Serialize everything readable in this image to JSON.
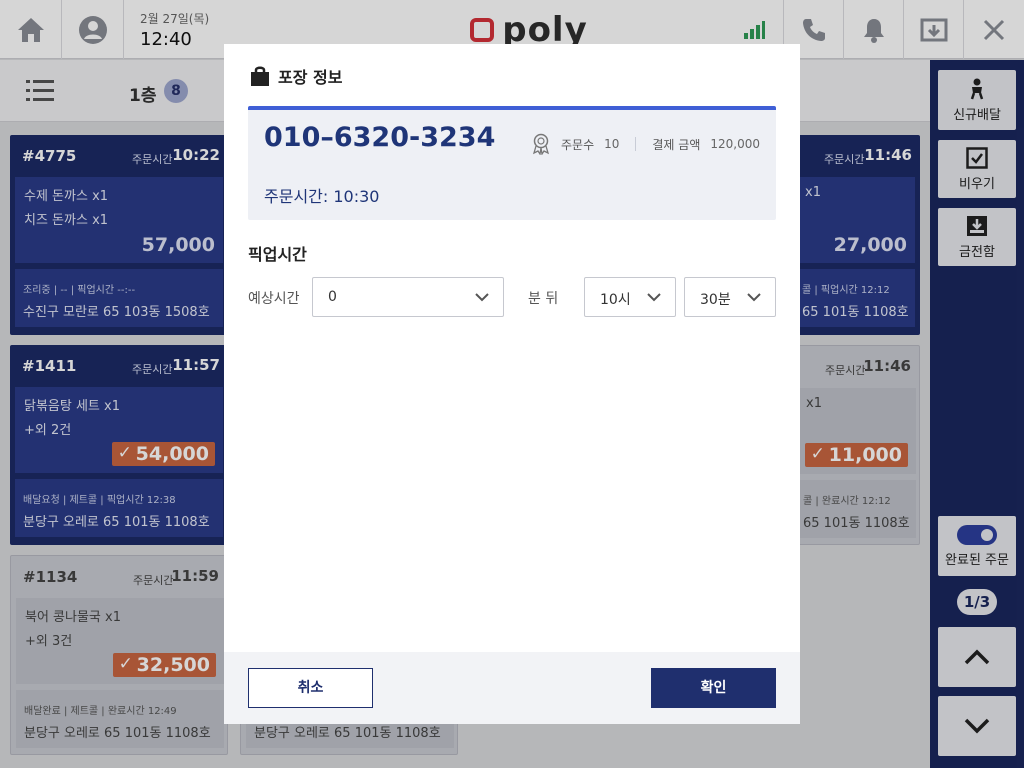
{
  "topbar": {
    "date": "2월 27일(목)",
    "time": "12:40",
    "logo_text": "poly"
  },
  "floorbar": {
    "floor_label": "1층",
    "floor_count": "8"
  },
  "cards": [
    {
      "order_no": "#4775",
      "time_label": "주문시간",
      "time": "10:22",
      "item1": "수제 돈까스  x1",
      "item2": "치즈 돈까스 x1",
      "price": "57,000",
      "status": "조리중     |      --      |     픽업시간 --:--",
      "address": "수진구 모란로 65 103동 1508호"
    },
    {
      "order_no": "#1411",
      "time_label": "주문시간",
      "time": "11:57",
      "item1": "닭볶음탕 세트  x1",
      "item2": "+외 2건",
      "price": "54,000",
      "status": "배달요청   |   제트콜   |   픽업시간 12:38",
      "address": "분당구 오레로 65 101동 1108호"
    },
    {
      "order_no": "#1134",
      "time_label": "주문시간",
      "time": "11:59",
      "item1": "북어 콩나물국  x1",
      "item2": "+외 3건",
      "price": "32,500",
      "status": "배달완료   |   제트콜   |   완료시간 12:49",
      "address": "분당구 오레로 65 101동 1108호"
    },
    {
      "time_label": "주문시간",
      "time": "11:46",
      "item1": "x1",
      "price": "27,000",
      "status": "콜     |   픽업시간 12:12",
      "address": "65 101동 1108호"
    },
    {
      "time_label": "주문시간",
      "time": "11:46",
      "item1": "x1",
      "price": "11,000",
      "status": "콜     |   완료시간 12:12",
      "address": "65 101동 1108호"
    },
    {
      "address": "분당구 오레로 65 101동 1108호"
    }
  ],
  "rpanel": {
    "new_delivery": "신규배달",
    "clear": "비우기",
    "cash_drawer": "금전함",
    "completed_orders": "완료된 주문",
    "page": "1/3"
  },
  "modal": {
    "title": "포장 정보",
    "phone": "010–6320-3234",
    "order_count_label": "주문수",
    "order_count": "10",
    "amount_label": "결제 금액",
    "amount": "120,000",
    "order_time": "주문시간: 10:30",
    "pickup_title": "픽업시간",
    "expected_label": "예상시간",
    "expected_value": "0",
    "after_label": "분 뒤",
    "hour_value": "10시",
    "minute_value": "30분",
    "cancel": "취소",
    "confirm": "확인"
  },
  "colors": {
    "navy": "#1f2f6e",
    "accent": "#3f5fd6",
    "price_badge": "#c96641",
    "signal_green": "#2f9b57",
    "logo_red": "#d6323a"
  }
}
